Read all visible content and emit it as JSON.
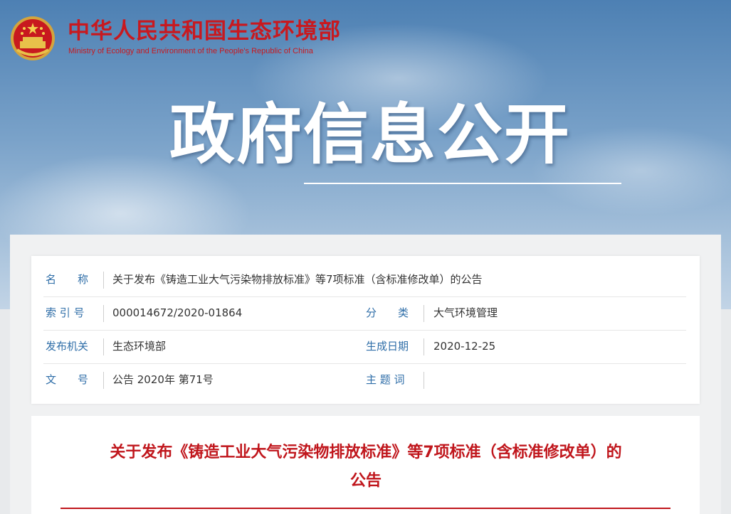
{
  "header": {
    "site_title": "中华人民共和国生态环境部",
    "site_subtitle": "Ministry of Ecology and Environment of the People's Republic of China",
    "emblem_icon": "national-emblem-icon"
  },
  "banner": {
    "title": "政府信息公开"
  },
  "metadata": {
    "name_label": "名　　称",
    "name_value": "关于发布《铸造工业大气污染物排放标准》等7项标准（含标准修改单）的公告",
    "index_label": "索 引 号",
    "index_value": "000014672/2020-01864",
    "category_label": "分　　类",
    "category_value": "大气环境管理",
    "issuer_label": "发布机关",
    "issuer_value": "生态环境部",
    "date_label": "生成日期",
    "date_value": "2020-12-25",
    "doc_number_label": "文　　号",
    "doc_number_value": "公告 2020年 第71号",
    "keywords_label": "主 题 词",
    "keywords_value": ""
  },
  "article": {
    "title": "关于发布《铸造工业大气污染物排放标准》等7项标准（含标准修改单）的公告"
  },
  "colors": {
    "brand_red": "#c8191f",
    "label_blue": "#2f6ea8",
    "text": "#333333"
  }
}
